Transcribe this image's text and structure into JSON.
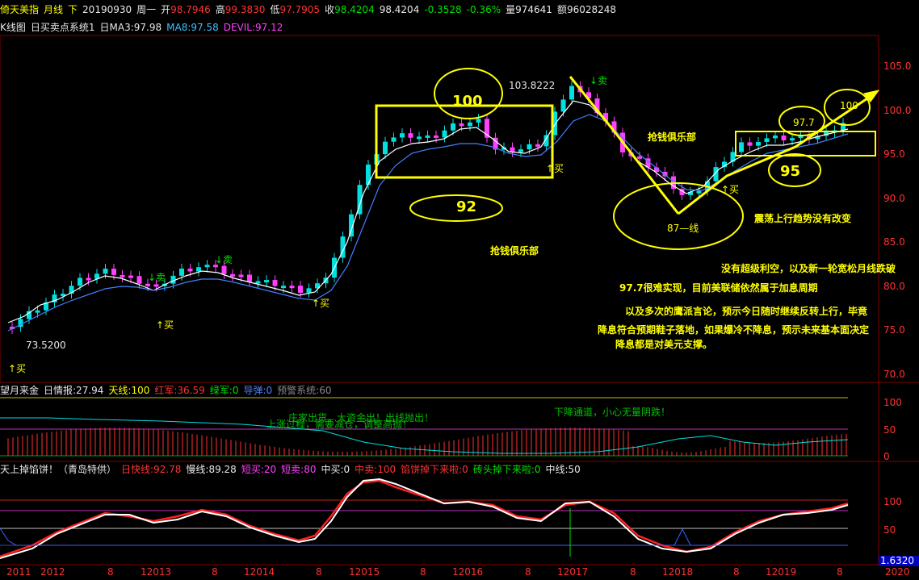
{
  "header": {
    "instrument": "倚天美指",
    "period": "月线",
    "mode": "下",
    "date": "20190930",
    "weekday": "周一",
    "open_label": "开",
    "open": "98.7946",
    "high_label": "高",
    "high": "99.3830",
    "low_label": "低",
    "low": "97.7905",
    "close_label": "收",
    "close": "98.4204",
    "last": "98.4204",
    "change": "-0.3528",
    "change_pct": "-0.36%",
    "volume_label": "量",
    "volume": "974641",
    "amount_label": "额",
    "amount": "96028248"
  },
  "ma_line": {
    "kline": "K线图",
    "system": "日买卖点系统1",
    "ma3": "日MA3:97.98",
    "ma8": "MA8:97.58",
    "devil": "DEVIL:97.12"
  },
  "price_axis": [
    "105.0",
    "100.0",
    "95.0",
    "90.0",
    "85.0",
    "80.0",
    "75.0",
    "70.0"
  ],
  "main_labels": {
    "low_price": "73.5200",
    "high_price": "103.8222",
    "buy": "↑买",
    "sell": "↓卖",
    "circle_100": "100",
    "circle_92": "92",
    "circle_977": "97.7",
    "circle_100b": "100",
    "circle_95": "95",
    "circle_87": "87—线",
    "club1": "抢钱俱乐部",
    "club2": "抢钱俱乐部",
    "trend": "震荡上行趋势没有改变",
    "note1": "没有超级利空，以及新一轮宽松月线跌破",
    "note2": "97.7很难实现，目前美联储依然属于加息周期",
    "note3": "以及多次的鹰派言论，预示今日随时继续反转上行，毕竟",
    "note4": "降息符合预期鞋子落地，如果爆冷不降息，预示未来基本面决定",
    "note5": "降息都是对美元支撑。"
  },
  "indicator1": {
    "name": "望月来金",
    "info": "日情报:27.94",
    "tianxian": "天线:100",
    "hongjun": "红军:36.59",
    "lvjun": "绿军:0",
    "daopao": "导弹:0",
    "yujing": "预警系统:60",
    "axis": [
      "100",
      "50",
      "0"
    ],
    "text_top": "下降通道，小心无量阴跌！",
    "text_mid1": "庄家出货，大资金出！出线抛出！",
    "text_mid2": "上涨过程，需要减仓，调整高抛！"
  },
  "indicator2": {
    "name": "天上掉馅饼！（青岛特供）",
    "kuaixian": "日快线:92.78",
    "manxian": "慢线:89.28",
    "duanmai": "短买:20",
    "duanmai2": "短卖:80",
    "zhongmai": "中买:0",
    "zhongmai2": "中卖:100",
    "xianbing": "馅饼掉下来啦:0",
    "zhuantou": "砖头掉下来啦:0",
    "zhongxian": "中线:50",
    "axis": [
      "100",
      "50"
    ],
    "corner": "1.6320"
  },
  "time_axis": [
    "2011",
    "2012",
    "8",
    "12013",
    "8",
    "12014",
    "8",
    "12015",
    "8",
    "12016",
    "8",
    "12017",
    "8",
    "12018",
    "8",
    "12019",
    "8",
    "2020"
  ],
  "colors": {
    "up": "#00e0e0",
    "down": "#ff40ff",
    "yellow": "#ffff00",
    "grid": "#800000"
  }
}
